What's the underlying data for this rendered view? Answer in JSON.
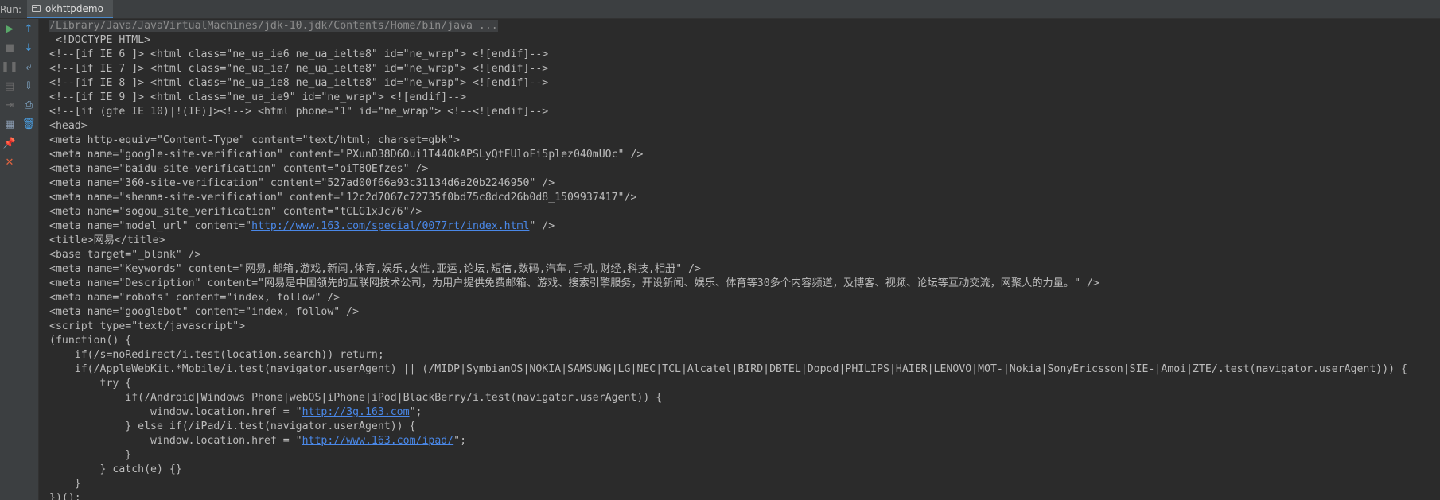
{
  "header": {
    "run_label": "Run:",
    "tab_label": "okhttpdemo"
  },
  "toolbar": {
    "left": [
      {
        "name": "rerun-button",
        "glyph": "▶",
        "color": "#59a869"
      },
      {
        "name": "stop-button",
        "glyph": "■",
        "color": "#6b6b6b"
      },
      {
        "name": "pause-button",
        "glyph": "❚❚",
        "color": "#6b6b6b"
      },
      {
        "name": "dump-threads-button",
        "glyph": "▤",
        "color": "#6b6b6b"
      },
      {
        "name": "exit-button",
        "glyph": "⇥",
        "color": "#6b6b6b"
      },
      {
        "name": "restore-layout-button",
        "glyph": "▦",
        "color": "#8a9bb0"
      },
      {
        "name": "pin-button",
        "glyph": "📌",
        "color": "#8a9bb0"
      },
      {
        "name": "close-button",
        "glyph": "✕",
        "color": "#e0633f"
      }
    ],
    "right": [
      {
        "name": "up-arrow-button",
        "glyph": "↑",
        "color": "#4a9de0"
      },
      {
        "name": "down-arrow-button",
        "glyph": "↓",
        "color": "#4a9de0"
      },
      {
        "name": "soft-wrap-button",
        "glyph": "⤶",
        "color": "#8ab4d8"
      },
      {
        "name": "scroll-to-end-button",
        "glyph": "⇩",
        "color": "#8ab4d8"
      },
      {
        "name": "print-button",
        "glyph": "⎙",
        "color": "#8ab4d8"
      },
      {
        "name": "clear-all-button",
        "glyph": "🗑",
        "color": "#4a9de0"
      }
    ]
  },
  "console": {
    "lines": [
      {
        "segs": [
          {
            "t": "/Library/Java/JavaVirtualMachines/jdk-10.jdk/Contents/Home/bin/java ...",
            "cls": "cmd"
          }
        ]
      },
      {
        "segs": [
          {
            "t": " <!DOCTYPE HTML>"
          }
        ]
      },
      {
        "segs": [
          {
            "t": "<!--[if IE 6 ]> <html class=\"ne_ua_ie6 ne_ua_ielte8\" id=\"ne_wrap\"> <![endif]-->"
          }
        ]
      },
      {
        "segs": [
          {
            "t": "<!--[if IE 7 ]> <html class=\"ne_ua_ie7 ne_ua_ielte8\" id=\"ne_wrap\"> <![endif]-->"
          }
        ]
      },
      {
        "segs": [
          {
            "t": "<!--[if IE 8 ]> <html class=\"ne_ua_ie8 ne_ua_ielte8\" id=\"ne_wrap\"> <![endif]-->"
          }
        ]
      },
      {
        "segs": [
          {
            "t": "<!--[if IE 9 ]> <html class=\"ne_ua_ie9\" id=\"ne_wrap\"> <![endif]-->"
          }
        ]
      },
      {
        "segs": [
          {
            "t": "<!--[if (gte IE 10)|!(IE)]><!--> <html phone=\"1\" id=\"ne_wrap\"> <!--<![endif]-->"
          }
        ]
      },
      {
        "segs": [
          {
            "t": "<head>"
          }
        ]
      },
      {
        "segs": [
          {
            "t": "<meta http-equiv=\"Content-Type\" content=\"text/html; charset=gbk\">"
          }
        ]
      },
      {
        "segs": [
          {
            "t": "<meta name=\"google-site-verification\" content=\"PXunD38D6Oui1T44OkAPSLyQtFUloFi5plez040mUOc\" />"
          }
        ]
      },
      {
        "segs": [
          {
            "t": "<meta name=\"baidu-site-verification\" content=\"oiT8OEfzes\" />"
          }
        ]
      },
      {
        "segs": [
          {
            "t": "<meta name=\"360-site-verification\" content=\"527ad00f66a93c31134d6a20b2246950\" />"
          }
        ]
      },
      {
        "segs": [
          {
            "t": "<meta name=\"shenma-site-verification\" content=\"12c2d7067c72735f0bd75c8dcd26b0d8_1509937417\"/>"
          }
        ]
      },
      {
        "segs": [
          {
            "t": "<meta name=\"sogou_site_verification\" content=\"tCLG1xJc76\"/>"
          }
        ]
      },
      {
        "segs": [
          {
            "t": "<meta name=\"model_url\" content=\""
          },
          {
            "t": "http://www.163.com/special/0077rt/index.html",
            "cls": "link"
          },
          {
            "t": "\" />"
          }
        ]
      },
      {
        "segs": [
          {
            "t": "<title>网易</title>"
          }
        ]
      },
      {
        "segs": [
          {
            "t": "<base target=\"_blank\" />"
          }
        ]
      },
      {
        "segs": [
          {
            "t": "<meta name=\"Keywords\" content=\"网易,邮箱,游戏,新闻,体育,娱乐,女性,亚运,论坛,短信,数码,汽车,手机,财经,科技,相册\" />"
          }
        ]
      },
      {
        "segs": [
          {
            "t": "<meta name=\"Description\" content=\"网易是中国领先的互联网技术公司，为用户提供免费邮箱、游戏、搜索引擎服务，开设新闻、娱乐、体育等30多个内容频道，及博客、视频、论坛等互动交流，网聚人的力量。\" />"
          }
        ]
      },
      {
        "segs": [
          {
            "t": "<meta name=\"robots\" content=\"index, follow\" />"
          }
        ]
      },
      {
        "segs": [
          {
            "t": "<meta name=\"googlebot\" content=\"index, follow\" />"
          }
        ]
      },
      {
        "segs": [
          {
            "t": "<script type=\"text/javascript\">"
          }
        ]
      },
      {
        "segs": [
          {
            "t": "(function() {"
          }
        ]
      },
      {
        "segs": [
          {
            "t": "    if(/s=noRedirect/i.test(location.search)) return;"
          }
        ]
      },
      {
        "segs": [
          {
            "t": "    if(/AppleWebKit.*Mobile/i.test(navigator.userAgent) || (/MIDP|SymbianOS|NOKIA|SAMSUNG|LG|NEC|TCL|Alcatel|BIRD|DBTEL|Dopod|PHILIPS|HAIER|LENOVO|MOT-|Nokia|SonyEricsson|SIE-|Amoi|ZTE/.test(navigator.userAgent))) {"
          }
        ]
      },
      {
        "segs": [
          {
            "t": "        try {"
          }
        ]
      },
      {
        "segs": [
          {
            "t": "            if(/Android|Windows Phone|webOS|iPhone|iPod|BlackBerry/i.test(navigator.userAgent)) {"
          }
        ]
      },
      {
        "segs": [
          {
            "t": "                window.location.href = \""
          },
          {
            "t": "http://3g.163.com",
            "cls": "link"
          },
          {
            "t": "\";"
          }
        ]
      },
      {
        "segs": [
          {
            "t": "            } else if(/iPad/i.test(navigator.userAgent)) {"
          }
        ]
      },
      {
        "segs": [
          {
            "t": "                window.location.href = \""
          },
          {
            "t": "http://www.163.com/ipad/",
            "cls": "link"
          },
          {
            "t": "\";"
          }
        ]
      },
      {
        "segs": [
          {
            "t": "            }"
          }
        ]
      },
      {
        "segs": [
          {
            "t": "        } catch(e) {}"
          }
        ]
      },
      {
        "segs": [
          {
            "t": "    }"
          }
        ]
      },
      {
        "segs": [
          {
            "t": "})();"
          }
        ]
      }
    ]
  }
}
